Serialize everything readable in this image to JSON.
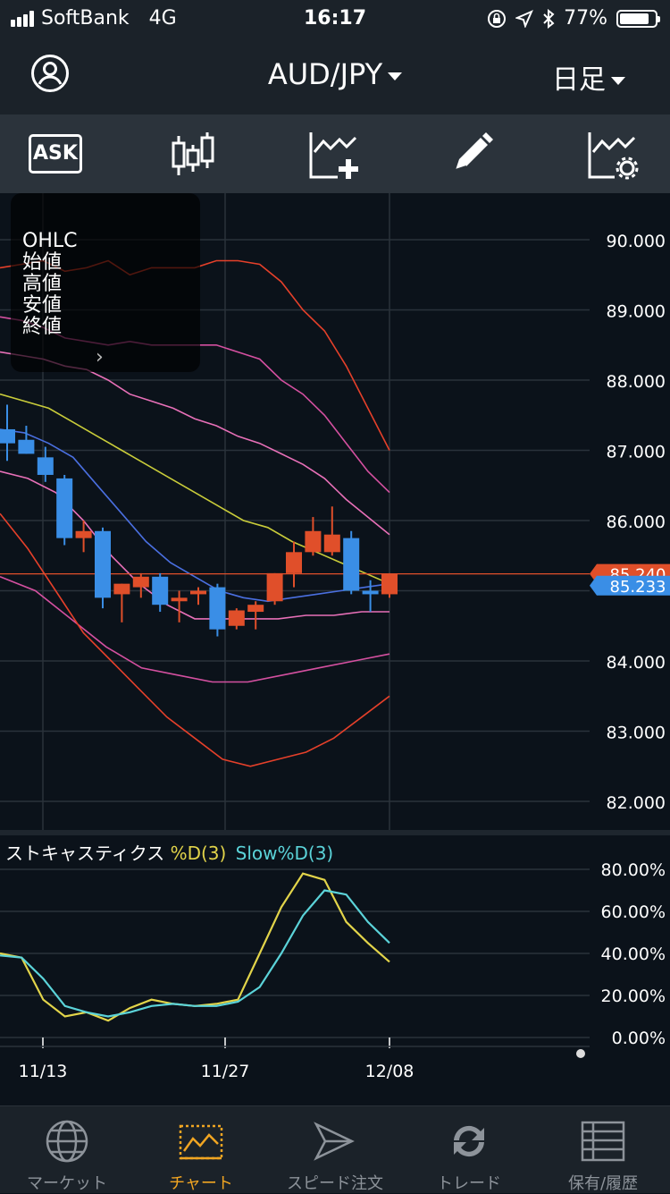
{
  "status_bar": {
    "carrier": "SoftBank",
    "network": "4G",
    "time": "16:17",
    "battery": "77%"
  },
  "header": {
    "pair": "AUD/JPY",
    "period": "日足",
    "avatar_icon": "user-circle-icon"
  },
  "toolbar": {
    "ask_label": "ASK",
    "items": [
      "candlestick-icon",
      "add-indicator-icon",
      "pencil-icon",
      "indicator-settings-icon"
    ]
  },
  "ohlc_panel": {
    "title": "OHLC",
    "open": "始値",
    "high": "高値",
    "low": "安値",
    "close": "終値"
  },
  "price_axis": [
    "90.000",
    "89.000",
    "88.000",
    "87.000",
    "86.000",
    "84.000",
    "83.000",
    "82.000"
  ],
  "price_tags": {
    "ask": "85.240",
    "bid": "85.233",
    "ask_color": "#e04f2a",
    "bid_color": "#3a8ee6"
  },
  "stochastics": {
    "name": "ストキャスティクス",
    "d_label": "%D(3)",
    "slow_label": "Slow%D(3)",
    "d_color": "#e2d44a",
    "slow_color": "#5bd3d9",
    "axis": [
      "80.00%",
      "60.00%",
      "40.00%",
      "20.00%",
      "0.00%"
    ]
  },
  "date_axis": [
    "11/13",
    "11/27",
    "12/08"
  ],
  "chart_data": {
    "type": "candlestick",
    "ylim": [
      81.6,
      91.0
    ],
    "up_color": "#e04f2a",
    "down_color": "#3a8ee6",
    "candles": [
      {
        "o": 87.3,
        "h": 87.65,
        "l": 86.85,
        "c": 87.1
      },
      {
        "o": 87.15,
        "h": 87.35,
        "l": 86.95,
        "c": 86.95
      },
      {
        "o": 86.9,
        "h": 87.05,
        "l": 86.55,
        "c": 86.65
      },
      {
        "o": 86.6,
        "h": 86.65,
        "l": 85.65,
        "c": 85.75
      },
      {
        "o": 85.75,
        "h": 86.0,
        "l": 85.55,
        "c": 85.85
      },
      {
        "o": 85.85,
        "h": 85.9,
        "l": 84.75,
        "c": 84.9
      },
      {
        "o": 84.95,
        "h": 85.1,
        "l": 84.55,
        "c": 85.1
      },
      {
        "o": 85.05,
        "h": 85.25,
        "l": 84.9,
        "c": 85.2
      },
      {
        "o": 85.2,
        "h": 85.25,
        "l": 84.7,
        "c": 84.8
      },
      {
        "o": 84.85,
        "h": 85.0,
        "l": 84.55,
        "c": 84.9
      },
      {
        "o": 84.95,
        "h": 85.05,
        "l": 84.8,
        "c": 85.0
      },
      {
        "o": 85.05,
        "h": 85.1,
        "l": 84.35,
        "c": 84.45
      },
      {
        "o": 84.5,
        "h": 84.75,
        "l": 84.45,
        "c": 84.72
      },
      {
        "o": 84.7,
        "h": 84.85,
        "l": 84.45,
        "c": 84.8
      },
      {
        "o": 84.85,
        "h": 85.25,
        "l": 84.8,
        "c": 85.25
      },
      {
        "o": 85.25,
        "h": 85.7,
        "l": 85.05,
        "c": 85.55
      },
      {
        "o": 85.55,
        "h": 86.05,
        "l": 85.5,
        "c": 85.85
      },
      {
        "o": 85.55,
        "h": 86.2,
        "l": 85.5,
        "c": 85.8
      },
      {
        "o": 85.75,
        "h": 85.85,
        "l": 84.95,
        "c": 85.0
      },
      {
        "o": 85.0,
        "h": 85.15,
        "l": 84.7,
        "c": 84.95
      },
      {
        "o": 84.95,
        "h": 85.25,
        "l": 84.9,
        "c": 85.24
      }
    ],
    "bollinger": {
      "upper3": [
        89.6,
        89.65,
        89.7,
        89.55,
        89.6,
        89.7,
        89.5,
        89.6,
        89.6,
        89.6,
        89.7,
        89.7,
        89.65,
        89.4,
        89.0,
        88.7,
        88.2,
        87.6,
        87.0
      ],
      "upper2": [
        88.9,
        88.85,
        88.75,
        88.6,
        88.55,
        88.5,
        88.55,
        88.5,
        88.5,
        88.5,
        88.5,
        88.4,
        88.3,
        88.0,
        87.8,
        87.5,
        87.1,
        86.7,
        86.4
      ],
      "upper1": [
        88.4,
        88.35,
        88.3,
        88.2,
        88.15,
        88.0,
        87.8,
        87.7,
        87.6,
        87.45,
        87.35,
        87.2,
        87.1,
        86.95,
        86.8,
        86.6,
        86.3,
        86.05,
        85.8
      ],
      "mid": [
        87.8,
        87.7,
        87.6,
        87.4,
        87.2,
        87.0,
        86.8,
        86.6,
        86.4,
        86.2,
        86.0,
        85.9,
        85.7,
        85.55,
        85.4,
        85.25,
        85.1
      ],
      "sma": [
        87.3,
        87.25,
        87.1,
        86.9,
        86.5,
        86.1,
        85.7,
        85.4,
        85.2,
        85.0,
        84.9,
        84.85,
        84.9,
        84.95,
        85.0,
        85.05,
        85.1
      ],
      "lower1": [
        86.7,
        86.6,
        86.4,
        86.0,
        85.5,
        85.1,
        84.8,
        84.6,
        84.6,
        84.6,
        84.6,
        84.65,
        84.65,
        84.7,
        84.7
      ],
      "lower2": [
        85.2,
        85.0,
        84.6,
        84.2,
        83.9,
        83.8,
        83.7,
        83.7,
        83.8,
        83.9,
        84.0,
        84.1
      ],
      "lower3": [
        86.1,
        85.6,
        85.0,
        84.4,
        84.0,
        83.6,
        83.2,
        82.9,
        82.6,
        82.5,
        82.6,
        82.7,
        82.9,
        83.2,
        83.5
      ]
    },
    "stoch_d": [
      40,
      38,
      18,
      10,
      12,
      8,
      14,
      18,
      16,
      15,
      16,
      18,
      40,
      62,
      78,
      75,
      55,
      45,
      36
    ],
    "stoch_slow": [
      39,
      38,
      28,
      15,
      12,
      10,
      12,
      15,
      16,
      15,
      15,
      17,
      24,
      40,
      58,
      70,
      68,
      55,
      45
    ]
  }
}
